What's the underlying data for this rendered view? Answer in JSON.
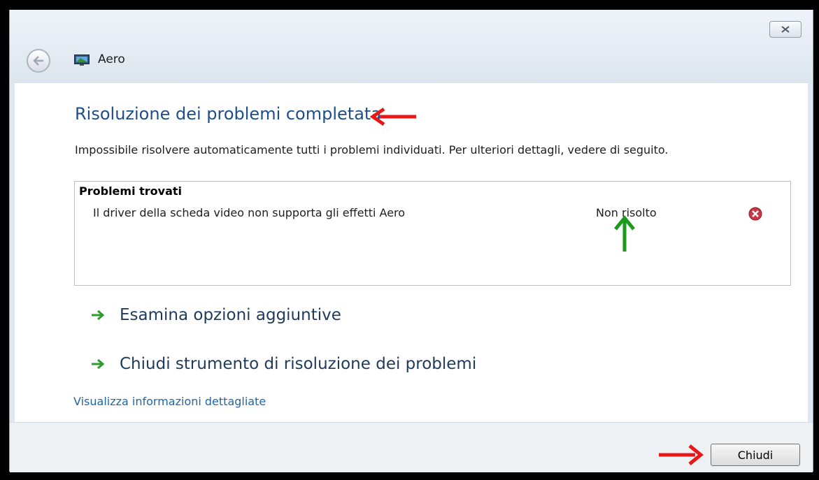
{
  "window": {
    "title": "Aero",
    "close_symbol": "✕"
  },
  "main": {
    "heading": "Risoluzione dei problemi completata",
    "description": "Impossibile risolvere automaticamente tutti i problemi individuati. Per ulteriori dettagli, vedere di seguito."
  },
  "problems": {
    "header": "Problemi trovati",
    "rows": [
      {
        "problem": "Il driver della scheda video non supporta gli effetti Aero",
        "status": "Non risolto",
        "status_icon": "error-icon"
      }
    ]
  },
  "options": [
    {
      "label": "Esamina opzioni aggiuntive"
    },
    {
      "label": "Chiudi strumento di risoluzione dei problemi"
    }
  ],
  "detail_link": "Visualizza informazioni dettagliate",
  "footer": {
    "close_button": "Chiudi"
  },
  "colors": {
    "heading": "#1f4f88",
    "link": "#1f66a6",
    "option_arrow": "#2e9d2e",
    "annotation_red": "#e81818",
    "annotation_green": "#1c9a1c"
  }
}
